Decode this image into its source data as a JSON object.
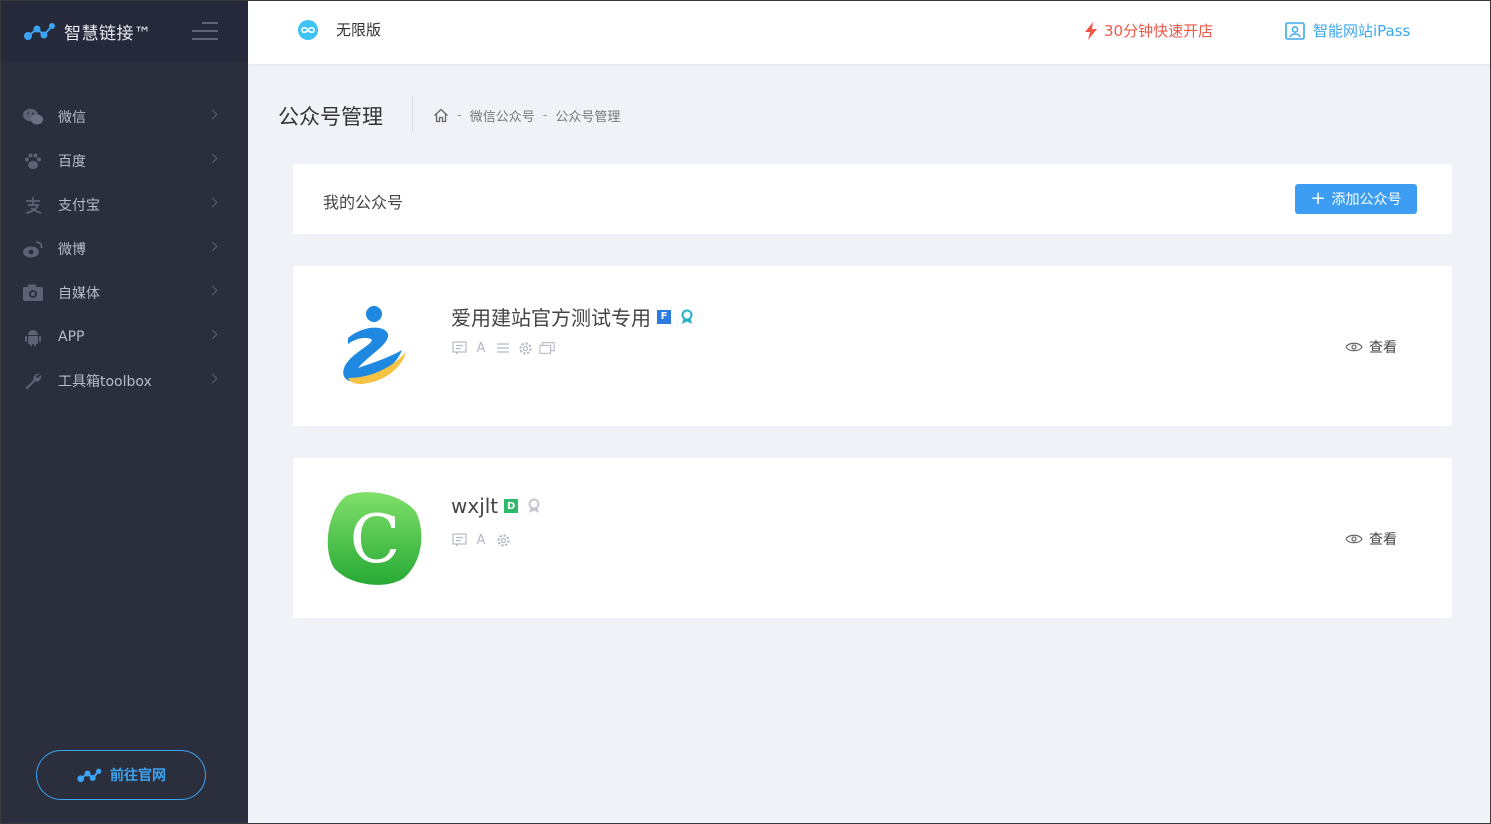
{
  "sidebar": {
    "brand_name": "智慧链接™",
    "items": [
      {
        "label": "微信",
        "icon": "wechat-icon"
      },
      {
        "label": "百度",
        "icon": "paw-icon"
      },
      {
        "label": "支付宝",
        "icon": "alipay-icon"
      },
      {
        "label": "微博",
        "icon": "weibo-icon"
      },
      {
        "label": "自媒体",
        "icon": "camera-icon"
      },
      {
        "label": "APP",
        "icon": "android-icon"
      },
      {
        "label": "工具箱toolbox",
        "icon": "wrench-icon"
      }
    ],
    "goto_label": "前往官网"
  },
  "topbar": {
    "edition_label": "无限版",
    "quick_open_label": "30分钟快速开店",
    "ipass_label": "智能网站iPass"
  },
  "page": {
    "title": "公众号管理",
    "breadcrumb": [
      "微信公众号",
      "公众号管理"
    ]
  },
  "panel": {
    "title": "我的公众号",
    "add_label": "添加公众号"
  },
  "accounts": [
    {
      "name": "爱用建站官方测试专用",
      "badge": "F",
      "verified": true,
      "view_label": "查看"
    },
    {
      "name": "wxjlt",
      "badge": "D",
      "verified": false,
      "view_label": "查看"
    }
  ],
  "colors": {
    "sidebar_bg": "#2b2e3d",
    "accent_blue": "#3d9df2",
    "quick_open_red": "#f0584a",
    "edition_cyan": "#3ec3f4"
  }
}
